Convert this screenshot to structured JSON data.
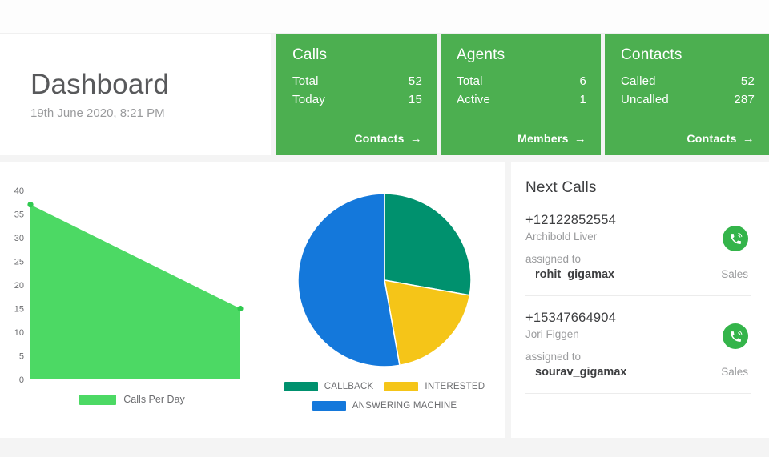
{
  "header": {
    "title": "Dashboard",
    "subtitle": "19th June 2020, 8:21 PM"
  },
  "stat_cards": [
    {
      "title": "Calls",
      "rows": [
        {
          "label": "Total",
          "value": "52"
        },
        {
          "label": "Today",
          "value": "15"
        }
      ],
      "link_label": "Contacts",
      "link_icon": "arrow-right-icon"
    },
    {
      "title": "Agents",
      "rows": [
        {
          "label": "Total",
          "value": "6"
        },
        {
          "label": "Active",
          "value": "1"
        }
      ],
      "link_label": "Members",
      "link_icon": "arrow-right-icon"
    },
    {
      "title": "Contacts",
      "rows": [
        {
          "label": "Called",
          "value": "52"
        },
        {
          "label": "Uncalled",
          "value": "287"
        }
      ],
      "link_label": "Contacts",
      "link_icon": "arrow-right-icon"
    }
  ],
  "next_calls": {
    "title": "Next Calls",
    "assigned_label": "assigned to",
    "call_icon": "phone-call-icon",
    "items": [
      {
        "phone": "+12122852554",
        "name": "Archibold Liver",
        "agent": "rohit_gigamax",
        "department": "Sales"
      },
      {
        "phone": "+15347664904",
        "name": "Jori Figgen",
        "agent": "sourav_gigamax",
        "department": "Sales"
      }
    ]
  },
  "colors": {
    "card_green": "#4caf50",
    "area_green": "#4cd964",
    "callback_teal": "#00916e",
    "interested_yellow": "#f5c518",
    "answering_blue": "#1478db",
    "call_button_green": "#34b44a"
  },
  "chart_data": [
    {
      "type": "area",
      "title": "",
      "xlabel": "",
      "ylabel": "",
      "ylim": [
        0,
        40
      ],
      "yticks": [
        0,
        5,
        10,
        15,
        20,
        25,
        30,
        35,
        40
      ],
      "grid": false,
      "legend_position": "bottom",
      "series": [
        {
          "name": "Calls Per Day",
          "color": "#4cd964",
          "x": [
            0,
            1
          ],
          "values": [
            37,
            15
          ]
        }
      ]
    },
    {
      "type": "pie",
      "title": "",
      "legend_position": "bottom",
      "labels": [
        "CALLBACK",
        "INTERESTED",
        "ANSWERING MACHINE"
      ],
      "values": [
        27.8,
        19.4,
        52.8
      ],
      "colors": [
        "#00916e",
        "#f5c518",
        "#1478db"
      ]
    }
  ]
}
